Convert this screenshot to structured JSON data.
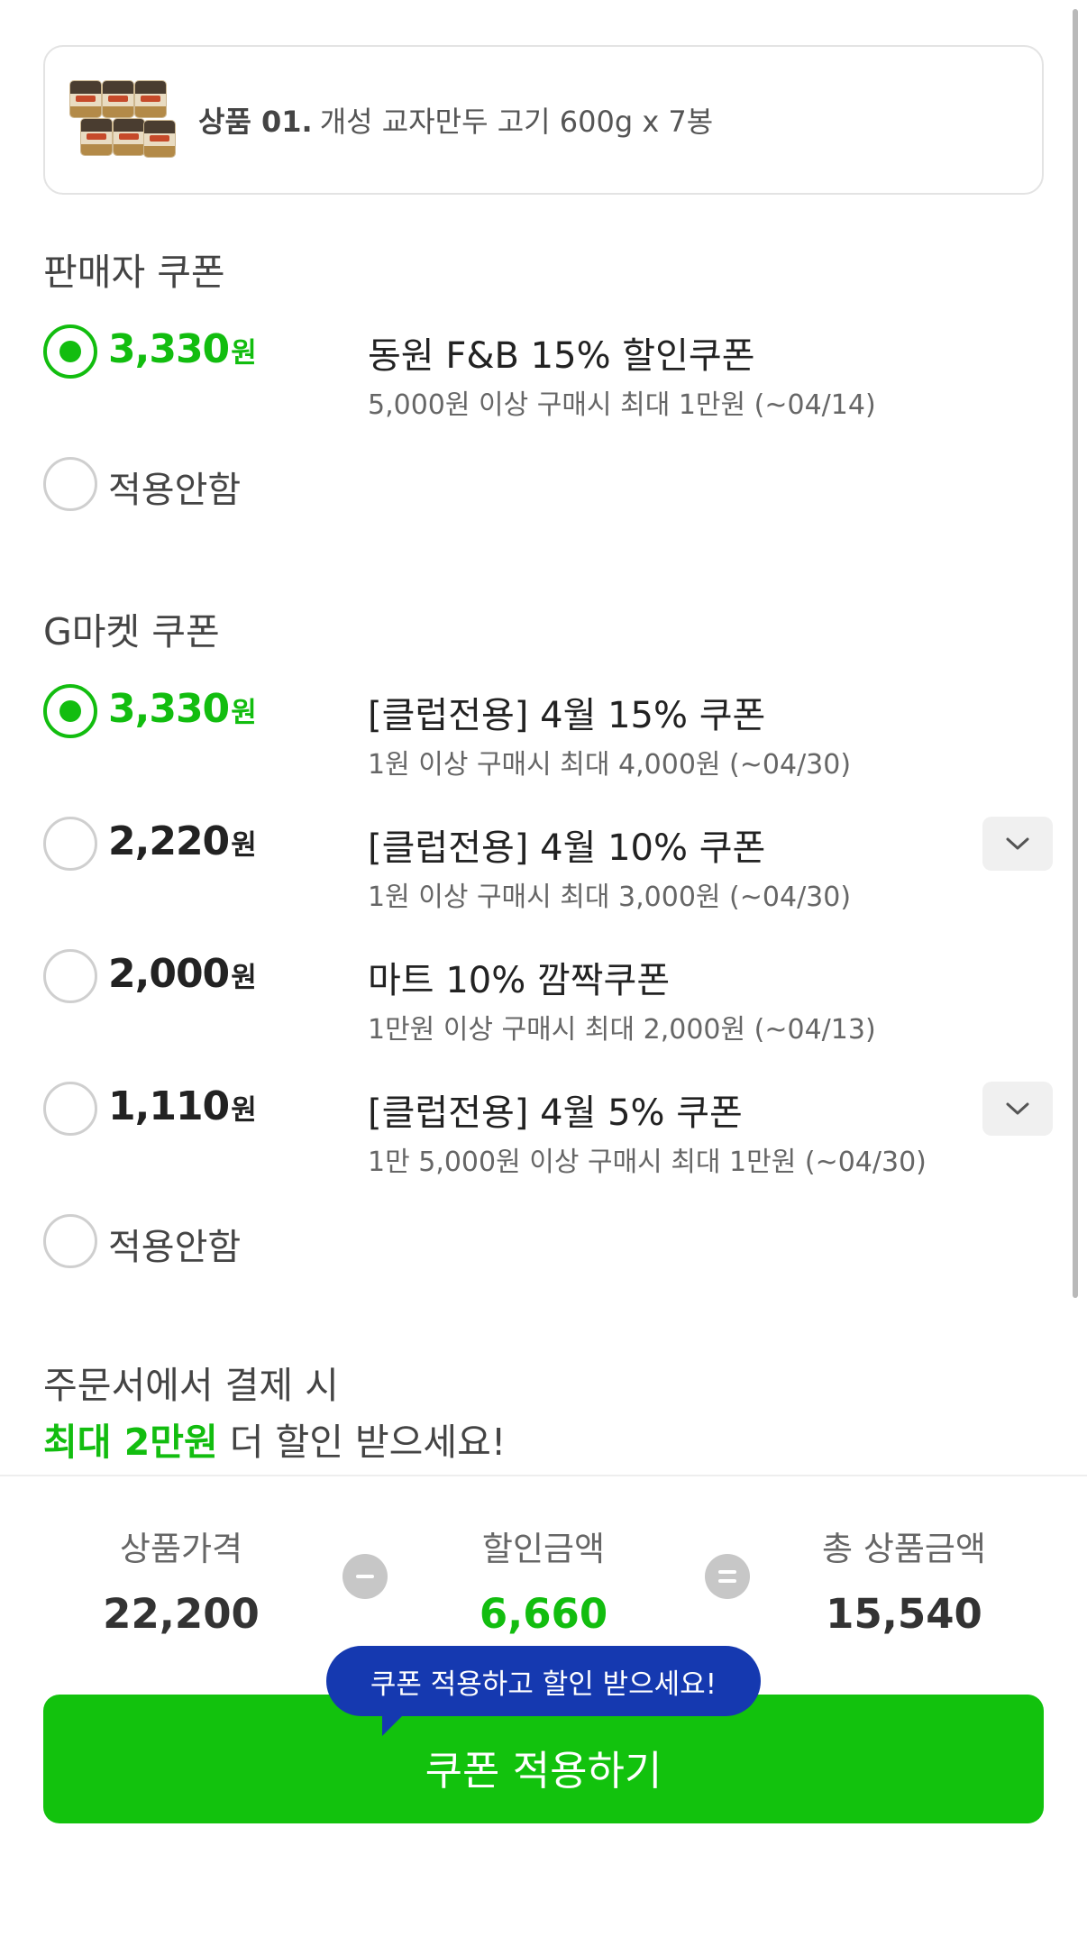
{
  "product": {
    "label": "상품 01.",
    "name": "개성 교자만두 고기 600g x 7봉",
    "thumb_icon": "dumpling-package-image"
  },
  "seller_section": {
    "title": "판매자 쿠폰",
    "coupons": [
      {
        "amount": "3,330",
        "unit": "원",
        "name": "동원 F&B 15% 할인쿠폰",
        "desc": "5,000원 이상 구매시 최대 1만원 (~04/14)",
        "selected": true
      }
    ],
    "no_apply": "적용안함"
  },
  "gmarket_section": {
    "title": "G마켓 쿠폰",
    "coupons": [
      {
        "amount": "3,330",
        "unit": "원",
        "name": "[클럽전용] 4월 15% 쿠폰",
        "desc": "1원 이상 구매시 최대 4,000원 (~04/30)",
        "selected": true
      },
      {
        "amount": "2,220",
        "unit": "원",
        "name": "[클럽전용] 4월 10% 쿠폰",
        "desc": "1원 이상 구매시 최대 3,000원 (~04/30)",
        "selected": false,
        "expand_icon": "chevron-down-icon"
      },
      {
        "amount": "2,000",
        "unit": "원",
        "name": "마트 10% 깜짝쿠폰",
        "desc": "1만원 이상 구매시 최대 2,000원 (~04/13)",
        "selected": false
      },
      {
        "amount": "1,110",
        "unit": "원",
        "name": "[클럽전용] 4월 5% 쿠폰",
        "desc": "1만 5,000원 이상 구매시 최대 1만원 (~04/30)",
        "selected": false,
        "expand_icon": "chevron-down-icon"
      }
    ],
    "no_apply": "적용안함"
  },
  "promo": {
    "line1": "주문서에서 결제 시",
    "highlight": "최대 2만원",
    "line2_rest": " 더 할인 받으세요!"
  },
  "summary": {
    "price_label": "상품가격",
    "price_value": "22,200",
    "discount_label": "할인금액",
    "discount_value": "6,660",
    "total_label": "총 상품금액",
    "total_value": "15,540"
  },
  "tooltip": "쿠폰 적용하고 할인 받으세요!",
  "cta_label": "쿠폰 적용하기",
  "colors": {
    "accent_green": "#12bd0f",
    "tooltip_blue": "#1539b0"
  }
}
